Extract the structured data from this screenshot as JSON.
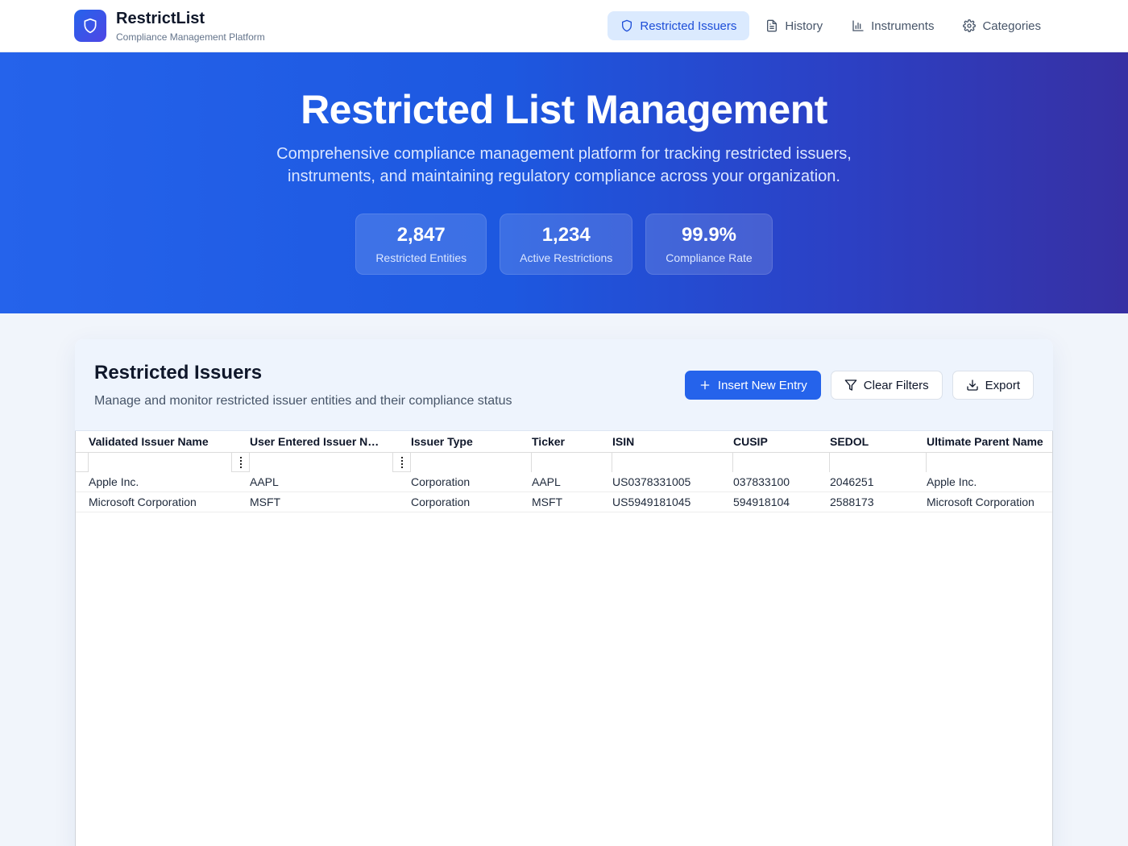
{
  "brand": {
    "name": "RestrictList",
    "subtitle": "Compliance Management Platform"
  },
  "nav": [
    {
      "label": "Restricted Issuers",
      "icon": "shield-icon",
      "active": true
    },
    {
      "label": "History",
      "icon": "document-icon",
      "active": false
    },
    {
      "label": "Instruments",
      "icon": "bar-chart-icon",
      "active": false
    },
    {
      "label": "Categories",
      "icon": "gear-icon",
      "active": false
    }
  ],
  "hero": {
    "title": "Restricted List Management",
    "description": "Comprehensive compliance management platform for tracking restricted issuers, instruments, and maintaining regulatory compliance across your organization.",
    "stats": [
      {
        "value": "2,847",
        "label": "Restricted Entities"
      },
      {
        "value": "1,234",
        "label": "Active Restrictions"
      },
      {
        "value": "99.9%",
        "label": "Compliance Rate"
      }
    ]
  },
  "card": {
    "title": "Restricted Issuers",
    "description": "Manage and monitor restricted issuer entities and their compliance status",
    "buttons": {
      "insert": "Insert New Entry",
      "clear": "Clear Filters",
      "export": "Export"
    }
  },
  "grid": {
    "columns": [
      "Validated Issuer Name",
      "User Entered Issuer N…",
      "Issuer Type",
      "Ticker",
      "ISIN",
      "CUSIP",
      "SEDOL",
      "Ultimate Parent Name"
    ],
    "rows": [
      [
        "Apple Inc.",
        "AAPL",
        "Corporation",
        "AAPL",
        "US0378331005",
        "037833100",
        "2046251",
        "Apple Inc."
      ],
      [
        "Microsoft Corporation",
        "MSFT",
        "Corporation",
        "MSFT",
        "US5949181045",
        "594918104",
        "2588173",
        "Microsoft Corporation"
      ]
    ]
  },
  "colors": {
    "accent": "#2563eb",
    "hero_start": "#2563eb",
    "hero_end": "#3730a3",
    "active_nav_bg": "#dbeafe"
  }
}
